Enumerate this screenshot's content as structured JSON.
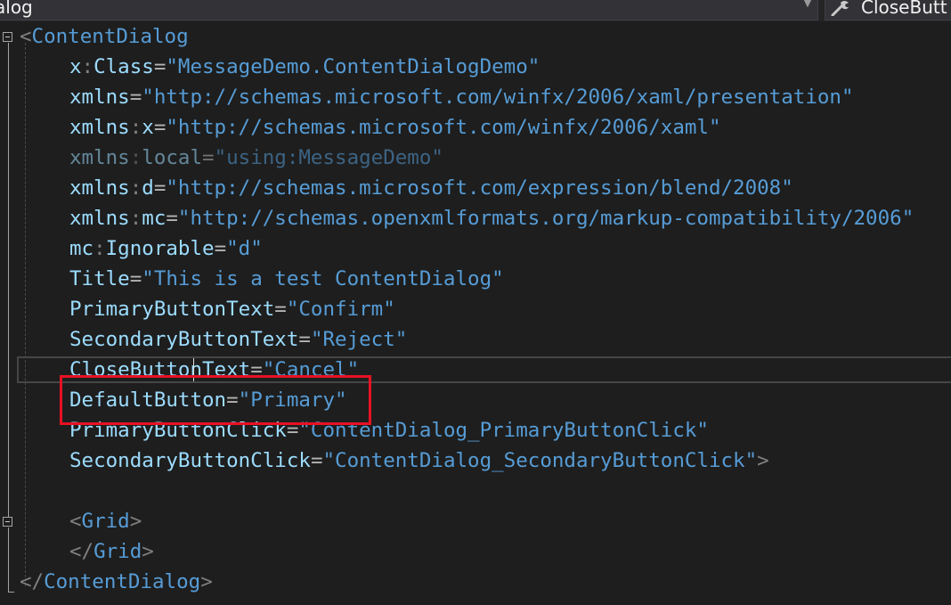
{
  "navbar": {
    "left_dropdown_text": "alog",
    "right_dropdown_text": "CloseButt"
  },
  "code": {
    "line1": {
      "bracket": "<",
      "tag": "ContentDialog"
    },
    "line2": {
      "prefix": "x",
      "colon": ":",
      "attr": "Class",
      "eq": "=",
      "value": "\"MessageDemo.ContentDialogDemo\""
    },
    "line3": {
      "attr": "xmlns",
      "eq": "=",
      "value": "\"http://schemas.microsoft.com/winfx/2006/xaml/presentation\""
    },
    "line4": {
      "prefix": "xmlns",
      "colon": ":",
      "attr": "x",
      "eq": "=",
      "value": "\"http://schemas.microsoft.com/winfx/2006/xaml\""
    },
    "line5": {
      "prefix": "xmlns",
      "colon": ":",
      "attr": "local",
      "eq": "=",
      "value": "\"using:MessageDemo\""
    },
    "line6": {
      "prefix": "xmlns",
      "colon": ":",
      "attr": "d",
      "eq": "=",
      "value": "\"http://schemas.microsoft.com/expression/blend/2008\""
    },
    "line7": {
      "prefix": "xmlns",
      "colon": ":",
      "attr": "mc",
      "eq": "=",
      "value": "\"http://schemas.openxmlformats.org/markup-compatibility/2006\""
    },
    "line8": {
      "prefix": "mc",
      "colon": ":",
      "attr": "Ignorable",
      "eq": "=",
      "value": "\"d\""
    },
    "line9": {
      "attr": "Title",
      "eq": "=",
      "value": "\"This is a test ContentDialog\""
    },
    "line10": {
      "attr": "PrimaryButtonText",
      "eq": "=",
      "value": "\"Confirm\""
    },
    "line11": {
      "attr": "SecondaryButtonText",
      "eq": "=",
      "value": "\"Reject\""
    },
    "line12": {
      "attr": "CloseButtonText",
      "eq": "=",
      "value": "\"Cancel\""
    },
    "line13": {
      "attr": "DefaultButton",
      "eq": "=",
      "value": "\"Primary\""
    },
    "line14": {
      "attr": "PrimaryButtonClick",
      "eq": "=",
      "value": "\"ContentDialog_PrimaryButtonClick\""
    },
    "line15": {
      "attr": "SecondaryButtonClick",
      "eq": "=",
      "value": "\"ContentDialog_SecondaryButtonClick\"",
      "close": ">"
    },
    "line17": {
      "open": "<",
      "tag": "Grid",
      "close": ">"
    },
    "line18": {
      "open": "</",
      "tag": "Grid",
      "close": ">"
    },
    "line19": {
      "open": "</",
      "tag": "ContentDialog",
      "close": ">"
    }
  },
  "colors": {
    "background": "#1e1e1e",
    "tag": "#569cd6",
    "attribute": "#9cdcfe",
    "value": "#569cd6",
    "punctuation": "#808080",
    "highlight": "#e81123"
  }
}
